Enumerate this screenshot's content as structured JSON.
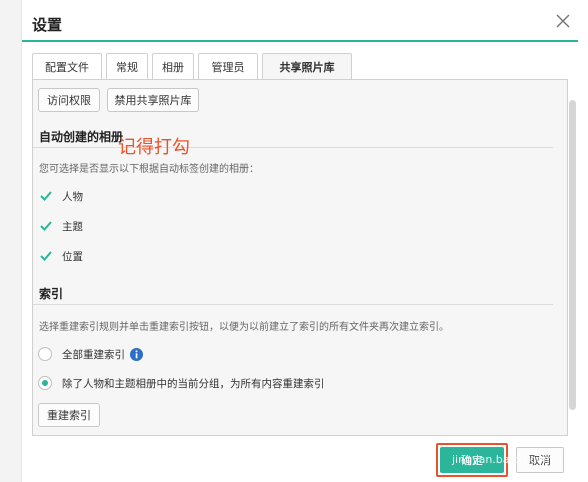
{
  "dialog": {
    "title": "设置"
  },
  "tabs": [
    {
      "label": "配置文件"
    },
    {
      "label": "常规"
    },
    {
      "label": "相册"
    },
    {
      "label": "管理员"
    },
    {
      "label": "共享照片库"
    }
  ],
  "toolbar": {
    "access_label": "访问权限",
    "disable_label": "禁用共享照片库"
  },
  "auto_albums": {
    "title": "自动创建的相册",
    "description": "您可选择是否显示以下根据自动标签创建的相册：",
    "items": [
      {
        "label": "人物",
        "checked": true
      },
      {
        "label": "主题",
        "checked": true
      },
      {
        "label": "位置",
        "checked": true
      }
    ]
  },
  "annotation": {
    "text": "记得打勾",
    "color": "#e8532b"
  },
  "index": {
    "title": "索引",
    "description": "选择重建索引规则并单击重建索引按钮，以便为以前建立了索引的所有文件夹再次建立索引。",
    "options": [
      {
        "label": "全部重建索引",
        "selected": false
      },
      {
        "label": "除了人物和主题相册中的当前分组，为所有内容重建索引",
        "selected": true
      }
    ],
    "rebuild_label": "重建索引"
  },
  "footer": {
    "ok_label": "确定",
    "cancel_label": "取消"
  },
  "watermark": {
    "text": "jingyan.baidu.com"
  },
  "colors": {
    "accent": "#2bb59b",
    "annotation": "#e8532b"
  }
}
